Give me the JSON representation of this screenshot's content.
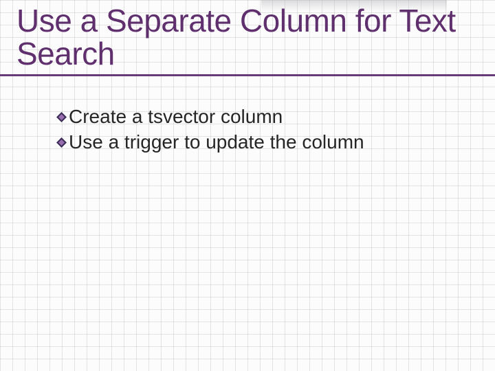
{
  "title": "Use a Separate Column for Text Search",
  "bullets": [
    {
      "text": "Create a tsvector column"
    },
    {
      "text": "Use a trigger to update the column"
    }
  ],
  "colors": {
    "title": "#5f2f6e",
    "underline": "#6a3a78",
    "bullet_outer": "#3b2d57",
    "bullet_inner": "#9a6fb0"
  }
}
